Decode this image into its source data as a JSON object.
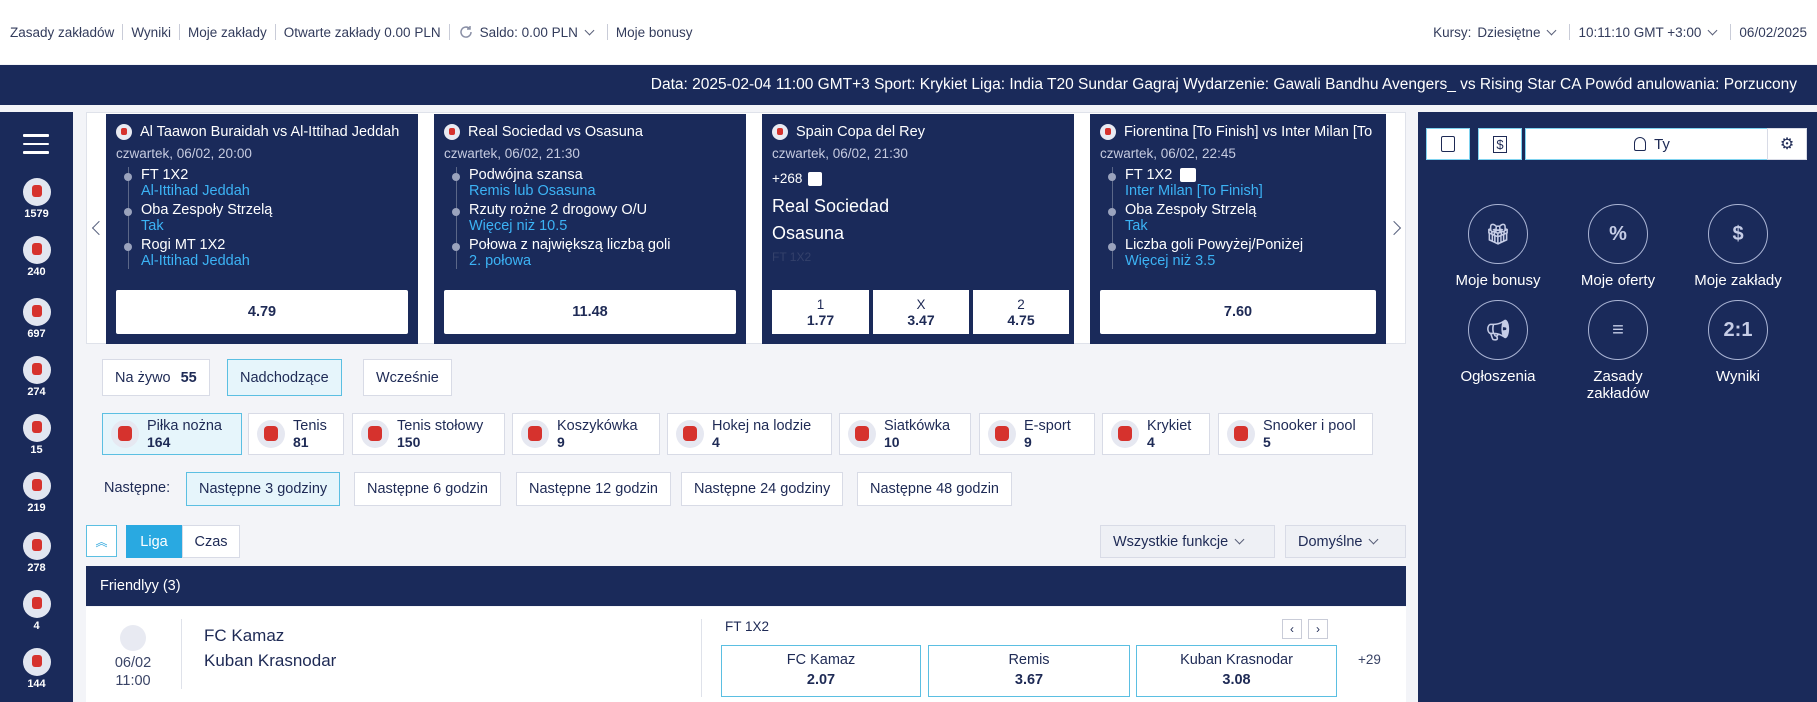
{
  "topbar": {
    "links": [
      "Zasady zakładów",
      "Wyniki",
      "Moje zakłady",
      "Otwarte zakłady 0.00 PLN"
    ],
    "balance": "Saldo: 0.00 PLN",
    "bonuses": "Moje bonusy",
    "odds_label": "Kursy:",
    "odds_value": "Dziesiętne",
    "time": "10:11:10 GMT +3:00",
    "date": "06/02/2025"
  },
  "ticker": "Data: 2025-02-04 11:00 GMT+3 Sport: Krykiet Liga: India T20 Sundar Gagraj Wydarzenie: Gawali Bandhu Avengers_ vs Rising Star CA Powód anulowania: Porzucony",
  "leftnav": {
    "counts": [
      "1579",
      "240",
      "697",
      "274",
      "15",
      "219",
      "278",
      "4",
      "144"
    ]
  },
  "cards": [
    {
      "title": "Al Taawon Buraidah vs Al-Ittihad Jeddah",
      "date": "czwartek, 06/02, 20:00",
      "legs": [
        {
          "market": "FT 1X2",
          "sel": "Al-Ittihad Jeddah"
        },
        {
          "market": "Oba Zespoły Strzelą",
          "sel": "Tak"
        },
        {
          "market": "Rogi MT 1X2",
          "sel": "Al-Ittihad Jeddah"
        }
      ],
      "odd": "4.79"
    },
    {
      "title": "Real Sociedad vs Osasuna",
      "date": "czwartek, 06/02, 21:30",
      "legs": [
        {
          "market": "Podwójna szansa",
          "sel": "Remis lub Osasuna"
        },
        {
          "market": "Rzuty rożne 2 drogowy O/U",
          "sel": "Więcej niż 10.5"
        },
        {
          "market": "Połowa z największą liczbą goli",
          "sel": "2. połowa"
        }
      ],
      "odd": "11.48"
    },
    {
      "title": "Spain Copa del Rey",
      "date": "czwartek, 06/02, 21:30",
      "more": "+268",
      "home": "Real Sociedad",
      "away": "Osasuna",
      "faded": "FT 1X2",
      "odds": [
        {
          "l": "1",
          "v": "1.77"
        },
        {
          "l": "X",
          "v": "3.47"
        },
        {
          "l": "2",
          "v": "4.75"
        }
      ]
    },
    {
      "title": "Fiorentina [To Finish] vs Inter Milan [To Finish]",
      "date": "czwartek, 06/02, 22:45",
      "legs": [
        {
          "market": "FT 1X2",
          "sel": "Inter Milan [To Finish]"
        },
        {
          "market": "Oba Zespoły Strzelą",
          "sel": "Tak"
        },
        {
          "market": "Liczba goli Powyżej/Poniżej",
          "sel": "Więcej niż 3.5"
        }
      ],
      "odd": "7.60"
    }
  ],
  "tabs": [
    {
      "label": "Na żywo",
      "count": "55"
    },
    {
      "label": "Nadchodzące"
    },
    {
      "label": "Wcześnie"
    }
  ],
  "sports": [
    {
      "name": "Piłka nożna",
      "count": "164"
    },
    {
      "name": "Tenis",
      "count": "81"
    },
    {
      "name": "Tenis stołowy",
      "count": "150"
    },
    {
      "name": "Koszykówka",
      "count": "9"
    },
    {
      "name": "Hokej na lodzie",
      "count": "4"
    },
    {
      "name": "Siatkówka",
      "count": "10"
    },
    {
      "name": "E-sport",
      "count": "9"
    },
    {
      "name": "Krykiet",
      "count": "4"
    },
    {
      "name": "Snooker i pool",
      "count": "5"
    }
  ],
  "next": {
    "label": "Następne:",
    "options": [
      "Następne 3 godziny",
      "Następne 6 godzin",
      "Następne 12 godzin",
      "Następne 24 godziny",
      "Następne 48 godzin"
    ]
  },
  "view": {
    "liga": "Liga",
    "czas": "Czas",
    "functions": "Wszystkie funkcje",
    "default": "Domyślne"
  },
  "league": "Friendlyy (3)",
  "match": {
    "date": "06/02",
    "time": "11:00",
    "home": "FC Kamaz",
    "away": "Kuban Krasnodar",
    "market": "FT 1X2",
    "odds": [
      {
        "l": "FC Kamaz",
        "v": "2.07"
      },
      {
        "l": "Remis",
        "v": "3.67"
      },
      {
        "l": "Kuban Krasnodar",
        "v": "3.08"
      }
    ],
    "more": "+29"
  },
  "right": {
    "user": "Ty",
    "items": [
      "Moje bonusy",
      "Moje oferty",
      "Moje zakłady",
      "Ogłoszenia",
      "Zasady zakładów",
      "Wyniki"
    ],
    "score_glyph": "2:1"
  }
}
